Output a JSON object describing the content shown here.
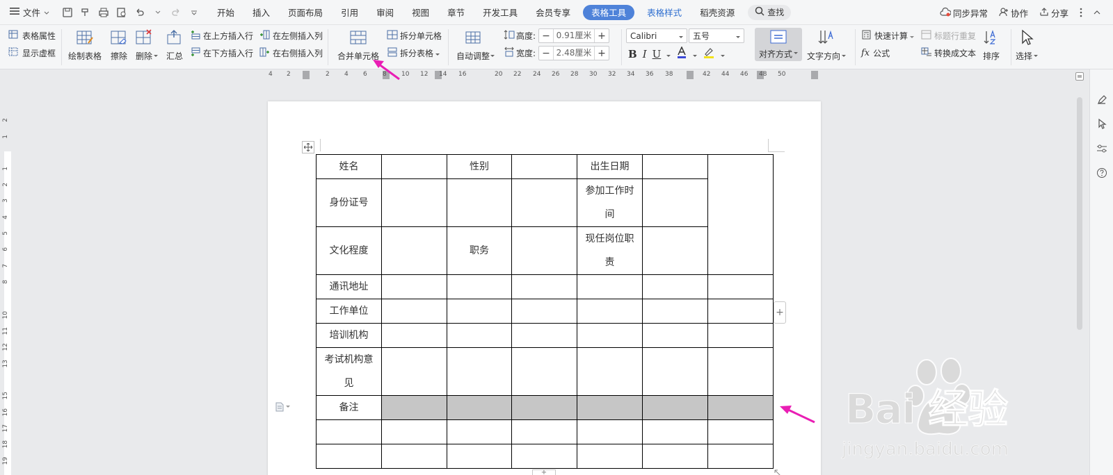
{
  "menubar": {
    "file_label": "文件",
    "tabs": [
      "开始",
      "插入",
      "页面布局",
      "引用",
      "审阅",
      "视图",
      "章节",
      "开发工具",
      "会员专享"
    ],
    "active_tab": "表格工具",
    "tab_table_style": "表格样式",
    "tab_resources": "稻壳资源",
    "search_label": "查找",
    "sync_label": "同步异常",
    "collab_label": "协作",
    "share_label": "分享"
  },
  "ribbon": {
    "table_props": "表格属性",
    "show_gridlines": "显示虚框",
    "draw_table": "绘制表格",
    "erase": "擦除",
    "delete": "删除",
    "summary": "汇总",
    "insert_above": "在上方插入行",
    "insert_below": "在下方插入行",
    "insert_left": "在左侧插入列",
    "insert_right": "在右侧插入列",
    "merge_cells": "合并单元格",
    "split_cells": "拆分单元格",
    "split_table": "拆分表格",
    "auto_fit": "自动调整",
    "height_label": "高度:",
    "height_value": "0.91厘米",
    "width_label": "宽度:",
    "width_value": "2.48厘米",
    "font_name": "Calibri",
    "font_size": "五号",
    "align": "对齐方式",
    "text_direction": "文字方向",
    "quick_calc": "快速计算",
    "repeat_header": "标题行重复",
    "formula": "公式",
    "to_text": "转换成文本",
    "sort": "排序",
    "select": "选择"
  },
  "ruler": {
    "h_ticks": [
      "4",
      "2",
      "2",
      "4",
      "6",
      "8",
      "10",
      "12",
      "14",
      "16",
      "20",
      "22",
      "24",
      "26",
      "28",
      "30",
      "32",
      "34",
      "36",
      "38",
      "42",
      "44",
      "46",
      "48",
      "50"
    ],
    "v_ticks": [
      "2",
      "1",
      "1",
      "2",
      "3",
      "4",
      "5",
      "6",
      "7",
      "8",
      "10",
      "11",
      "12",
      "13",
      "15",
      "16",
      "17",
      "18",
      "19"
    ]
  },
  "table": {
    "r1": [
      "姓名",
      "",
      "性别",
      "",
      "出生日期",
      ""
    ],
    "r2": [
      "身份证号",
      "",
      "",
      "",
      "参加工作时间",
      ""
    ],
    "r3": [
      "文化程度",
      "",
      "职务",
      "",
      "现任岗位职责",
      ""
    ],
    "r4": "通讯地址",
    "r5": "工作单位",
    "r6": "培训机构",
    "r7": "考试机构意见",
    "r8": "备注"
  },
  "watermark": {
    "brand": "Bai 经验",
    "url": "jingyan.baidu.com"
  },
  "colors": {
    "accent": "#4e82d9",
    "annotation_arrow": "#e91eb4",
    "selected_cells": "#c6c6c6"
  }
}
